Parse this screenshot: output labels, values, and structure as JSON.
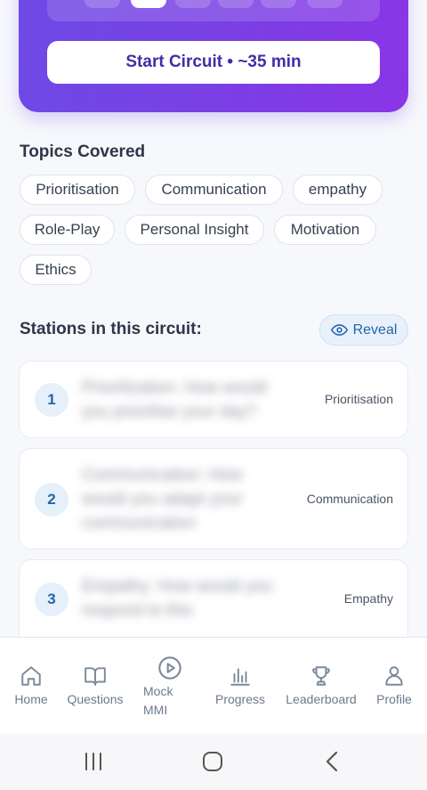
{
  "hero": {
    "start_button": "Start Circuit • ~35 min",
    "accent": "#7b3fe4"
  },
  "topics": {
    "title": "Topics Covered",
    "chips": [
      "Prioritisation",
      "Communication",
      "empathy",
      "Role-Play",
      "Personal Insight",
      "Motivation",
      "Ethics"
    ]
  },
  "stations": {
    "title": "Stations in this circuit:",
    "reveal_label": "Reveal",
    "items": [
      {
        "number": "1",
        "question_lines": [
          "Prioritization: How would",
          "you prioritise your day?"
        ],
        "tag": "Prioritisation"
      },
      {
        "number": "2",
        "question_lines": [
          "Communication: How",
          "would you adapt your",
          "communication"
        ],
        "tag": "Communication"
      },
      {
        "number": "3",
        "question_lines": [
          "Empathy: How would you",
          "respond to this"
        ],
        "tag": "Empathy"
      }
    ]
  },
  "nav": {
    "items": [
      {
        "label": "Home",
        "icon": "home-icon"
      },
      {
        "label": "Questions",
        "icon": "book-icon"
      },
      {
        "label": "Mock MMI",
        "icon": "play-circle-icon"
      },
      {
        "label": "Progress",
        "icon": "bar-chart-icon"
      },
      {
        "label": "Leaderboard",
        "icon": "trophy-icon"
      },
      {
        "label": "Profile",
        "icon": "user-icon"
      }
    ]
  },
  "system_bar": {
    "buttons": [
      "recent-apps-icon",
      "home-circle-icon",
      "back-icon"
    ]
  }
}
